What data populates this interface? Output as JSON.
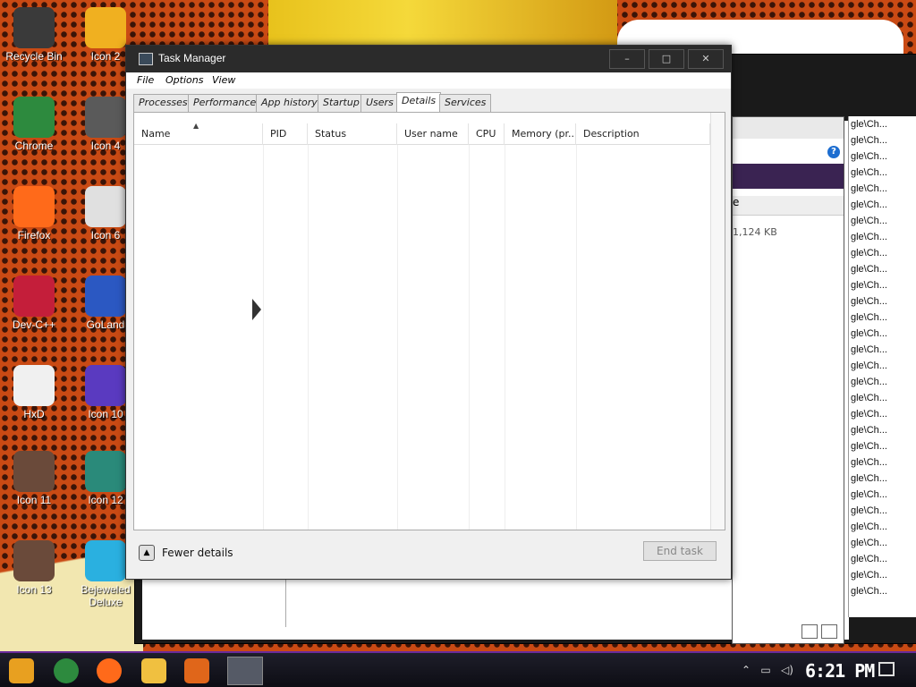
{
  "desktop": {
    "banner_text": "",
    "icons": [
      {
        "label": "Recycle Bin",
        "color": "#3a3a3a"
      },
      {
        "label": "Icon 2",
        "color": "#f0b020"
      },
      {
        "label": "Chrome",
        "color": "#2d8a3e"
      },
      {
        "label": "Icon 4",
        "color": "#5a5a5a"
      },
      {
        "label": "Firefox",
        "color": "#ff6a1a"
      },
      {
        "label": "Icon 6",
        "color": "#e0e0e0"
      },
      {
        "label": "Dev-C++",
        "color": "#c41e3a"
      },
      {
        "label": "GoLand",
        "color": "#2b58c2"
      },
      {
        "label": "HxD",
        "color": "#f0f0f0"
      },
      {
        "label": "Icon 10",
        "color": "#5a3ac0"
      },
      {
        "label": "Icon 11",
        "color": "#6a4a3a"
      },
      {
        "label": "Icon 12",
        "color": "#2a8a7a"
      },
      {
        "label": "Icon 13",
        "color": "#6a4a3a"
      },
      {
        "label": "Bejeweled Deluxe",
        "color": "#2ab0e0"
      }
    ]
  },
  "task_manager": {
    "title": "Task Manager",
    "window_controls": [
      "–",
      "□",
      "✕"
    ],
    "menu": [
      "File",
      "Options",
      "View"
    ],
    "tabs": [
      "Processes",
      "Performance",
      "App history",
      "Startup",
      "Users",
      "Details",
      "Services"
    ],
    "active_tab": "Details",
    "columns": [
      "Name",
      "PID",
      "Status",
      "User name",
      "CPU",
      "Memory (pr...",
      "Description"
    ],
    "footer": {
      "fewer_details": "Fewer details",
      "end_task": "End task"
    }
  },
  "background_window": {
    "size_text": "1,124 KB",
    "column_text": "e",
    "path_fragment": "gle\\Ch..."
  },
  "taskbar": {
    "clock": "6:21 PM",
    "accent": "#6a2b9a"
  }
}
